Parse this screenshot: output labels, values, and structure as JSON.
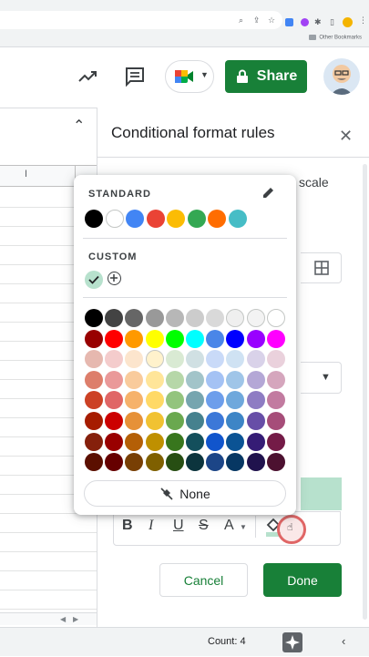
{
  "browser": {
    "other_bookmarks": "Other Bookmarks"
  },
  "toolbar": {
    "share_label": "Share",
    "trend_icon": "trending-up-icon",
    "comment_icon": "comment-icon",
    "meet_icon": "meet-icon",
    "avatar_icon": "avatar"
  },
  "sheet": {
    "col_label": "I"
  },
  "panel": {
    "title": "Conditional format rules",
    "scale_text": "scale",
    "cancel_label": "Cancel",
    "done_label": "Done",
    "format_bold": "B",
    "format_italic": "I",
    "format_underline": "U",
    "format_strike": "S",
    "format_text_color": "A"
  },
  "color_picker": {
    "standard_label": "STANDARD",
    "custom_label": "CUSTOM",
    "none_label": "None",
    "standard_colors": [
      "#000000",
      "#ffffff",
      "#4285f4",
      "#ea4335",
      "#fbbc04",
      "#34a853",
      "#ff6d01",
      "#46bdc6"
    ],
    "custom_colors": [
      "#b7e1cd"
    ],
    "palette": [
      [
        "#000000",
        "#434343",
        "#666666",
        "#999999",
        "#b7b7b7",
        "#cccccc",
        "#d9d9d9",
        "#efefef",
        "#f3f3f3",
        "#ffffff"
      ],
      [
        "#980000",
        "#ff0000",
        "#ff9900",
        "#ffff00",
        "#00ff00",
        "#00ffff",
        "#4a86e8",
        "#0000ff",
        "#9900ff",
        "#ff00ff"
      ],
      [
        "#e6b8af",
        "#f4cccc",
        "#fce5cd",
        "#fff2cc",
        "#d9ead3",
        "#d0e0e3",
        "#c9daf8",
        "#cfe2f3",
        "#d9d2e9",
        "#ead1dc"
      ],
      [
        "#dd7e6b",
        "#ea9999",
        "#f9cb9c",
        "#ffe599",
        "#b6d7a8",
        "#a2c4c9",
        "#a4c2f4",
        "#9fc5e8",
        "#b4a7d6",
        "#d5a6bd"
      ],
      [
        "#cc4125",
        "#e06666",
        "#f6b26b",
        "#ffd966",
        "#93c47d",
        "#76a5af",
        "#6d9eeb",
        "#6fa8dc",
        "#8e7cc3",
        "#c27ba0"
      ],
      [
        "#a61c00",
        "#cc0000",
        "#e69138",
        "#f1c232",
        "#6aa84f",
        "#45818e",
        "#3c78d8",
        "#3d85c6",
        "#674ea7",
        "#a64d79"
      ],
      [
        "#85200c",
        "#990000",
        "#b45f06",
        "#bf9000",
        "#38761d",
        "#134f5c",
        "#1155cc",
        "#0b5394",
        "#351c75",
        "#741b47"
      ],
      [
        "#5b0f00",
        "#660000",
        "#783f04",
        "#7f6000",
        "#274e13",
        "#0c343d",
        "#1c4587",
        "#073763",
        "#20124d",
        "#4c1130"
      ]
    ]
  },
  "status": {
    "count": "Count: 4"
  },
  "colors": {
    "accent_green": "#188038",
    "selected_fill": "#b7e1cd"
  }
}
